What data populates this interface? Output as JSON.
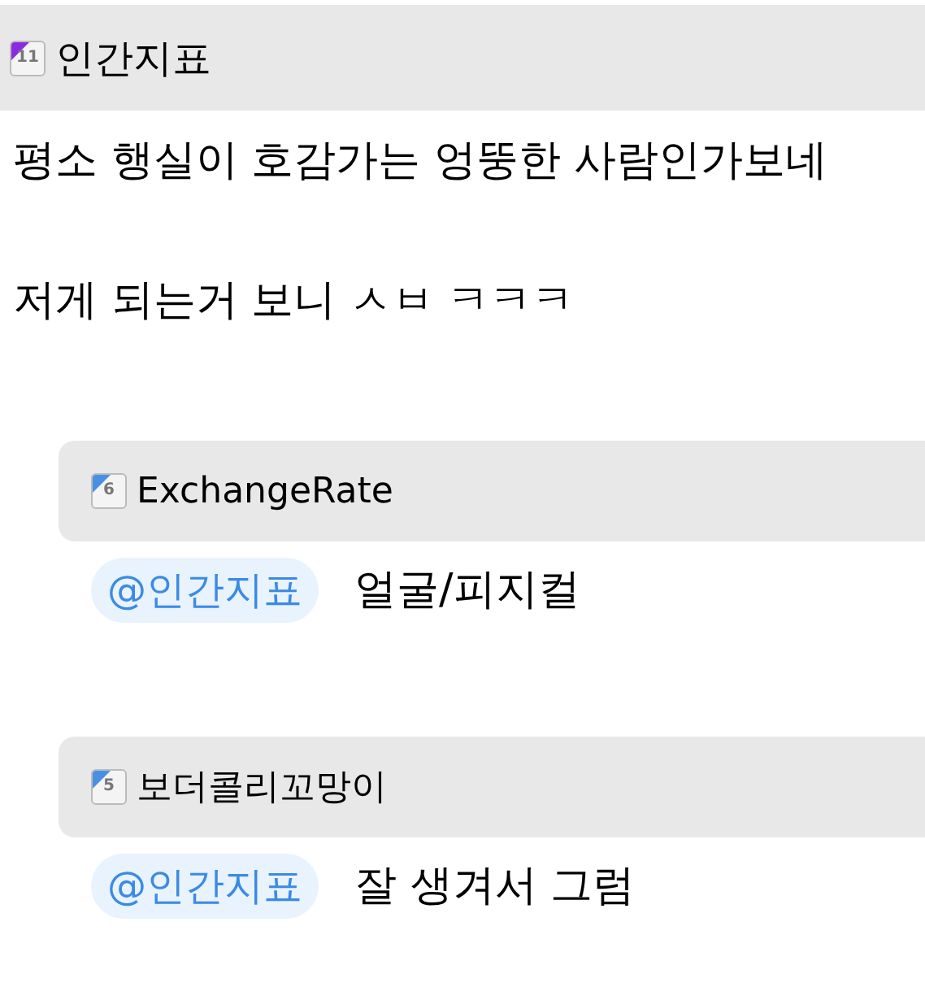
{
  "post": {
    "author": {
      "name": "인간지표",
      "level": "11",
      "color": "#8a2be2"
    },
    "lines": [
      "평소 행실이 호감가는 엉뚱한 사람인가보네",
      "저게 되는거 보니 ㅅㅂ ㅋㅋㅋ"
    ]
  },
  "replies": [
    {
      "author": {
        "name": "ExchangeRate",
        "level": "6",
        "color": "#4a90e2"
      },
      "mention": "@인간지표",
      "text": "얼굴/피지컬"
    },
    {
      "author": {
        "name": "보더콜리꼬망이",
        "level": "5",
        "color": "#4a90e2"
      },
      "mention": "@인간지표",
      "text": "잘 생겨서 그럼"
    }
  ]
}
